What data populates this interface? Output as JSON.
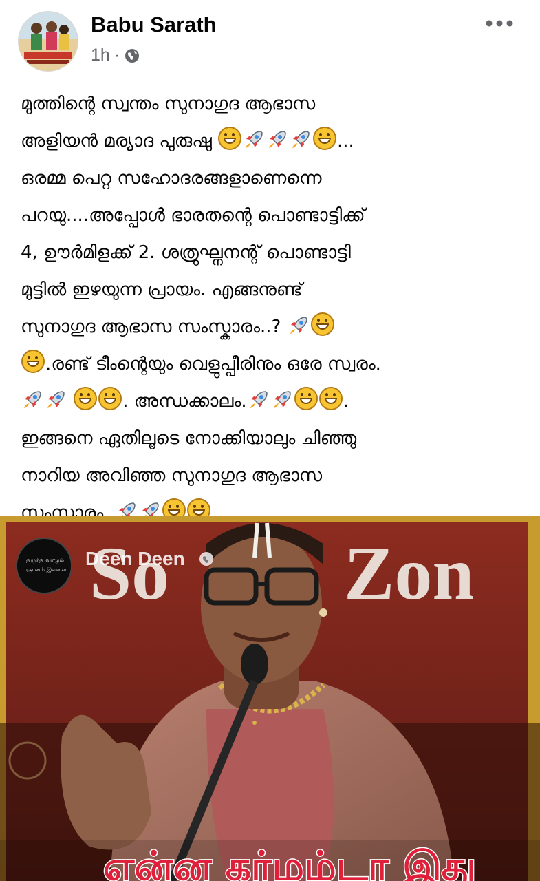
{
  "post": {
    "author": "Babu Sarath",
    "time": "1h",
    "privacy_sep": "·",
    "privacy_icon": "globe-icon",
    "more_icon": "more-options-icon",
    "text_lines": [
      [
        {
          "t": "മുത്തിന്റെ സ്വന്തം സുനാഗുദ ആഭാസ"
        }
      ],
      [
        {
          "t": "അളിയൻ മര്യാദ പുരുഷു "
        },
        {
          "e": "smile"
        },
        {
          "e": "rocket"
        },
        {
          "e": "rocket"
        },
        {
          "e": "rocket"
        },
        {
          "e": "smile"
        },
        {
          "t": "..."
        }
      ],
      [
        {
          "t": "ഒരമ്മ പെറ്റ സഹോദരങ്ങളാണെന്നെ"
        }
      ],
      [
        {
          "t": "പറയു....അപ്പോൾ ഭാരതന്റെ പൊണ്ടാട്ടിക്ക്"
        }
      ],
      [
        {
          "t": "4,  ഊർമിളക്ക് 2. ശത്രുഘ്നനന്റ് പൊണ്ടാട്ടി"
        }
      ],
      [
        {
          "t": "മുട്ടിൽ ഇഴയുന്ന പ്രായം. എങ്ങനുണ്ട്"
        }
      ],
      [
        {
          "t": "സുനാഗുദ ആഭാസ സംസ്കാരം..?  "
        },
        {
          "e": "rocket"
        },
        {
          "e": "smile"
        }
      ],
      [
        {
          "e": "smile"
        },
        {
          "t": ".രണ്ട് ടീംന്റെയും വെളുപ്പീരിനും ഒരേ സ്വരം."
        }
      ],
      [
        {
          "e": "rocket"
        },
        {
          "e": "rocket"
        },
        {
          "t": "  "
        },
        {
          "e": "smile"
        },
        {
          "e": "smile"
        },
        {
          "t": ". അന്ധക്കാലം."
        },
        {
          "e": "rocket"
        },
        {
          "e": "rocket"
        },
        {
          "e": "smile"
        },
        {
          "e": "smile"
        },
        {
          "t": "."
        }
      ],
      [
        {
          "t": "ഇങ്ങനെ ഏതിലൂടെ നോക്കിയാലും ചിഞ്ഞു"
        }
      ],
      [
        {
          "t": "നാറിയ അവിഞ്ഞ സുനാഗുദ ആഭാസ"
        }
      ],
      [
        {
          "t": "സംസ്കാരം. "
        },
        {
          "e": "rocket"
        },
        {
          "e": "rocket"
        },
        {
          "e": "smile"
        },
        {
          "e": "smile"
        }
      ]
    ]
  },
  "video": {
    "channel_name": "Deen Deen",
    "globe_icon": "globe-icon",
    "banner_text": "So    Zon",
    "caption": "என்ன கர்மம்டா இது",
    "colors": {
      "backdrop": "#8c2a1e",
      "frame": "#c89b2e",
      "caption_red": "#e0203a"
    }
  }
}
